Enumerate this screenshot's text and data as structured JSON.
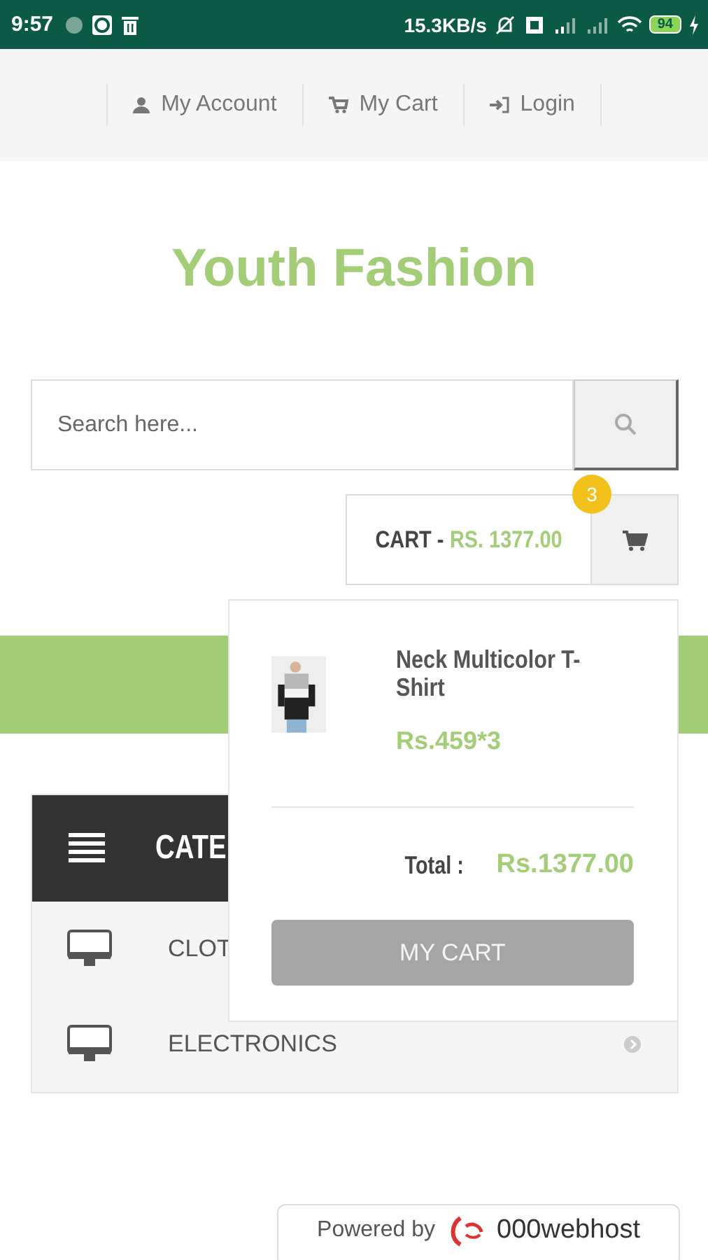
{
  "status_bar": {
    "time": "9:57",
    "speed": "15.3KB/s",
    "battery": "94"
  },
  "top_nav": [
    {
      "label": "My Account"
    },
    {
      "label": "My Cart"
    },
    {
      "label": "Login"
    }
  ],
  "site_title": "Youth Fashion",
  "search": {
    "placeholder": "Search here..."
  },
  "cart": {
    "label": "CART -",
    "amount": "RS. 1377.00",
    "count": "3"
  },
  "cart_dropdown": {
    "items": [
      {
        "name": "Neck Multicolor T-Shirt",
        "price": "Rs.459*3",
        "kind": "picture"
      }
    ],
    "total_label": "Total :",
    "total": "Rs.1377.00",
    "button": "MY CART"
  },
  "categories": {
    "title": "CATE",
    "items": [
      {
        "label": "CLOT"
      },
      {
        "label": "ELECTRONICS",
        "arrow_visible": true
      }
    ]
  },
  "footer": {
    "powered_by": "Powered by",
    "host": "000webhost"
  }
}
